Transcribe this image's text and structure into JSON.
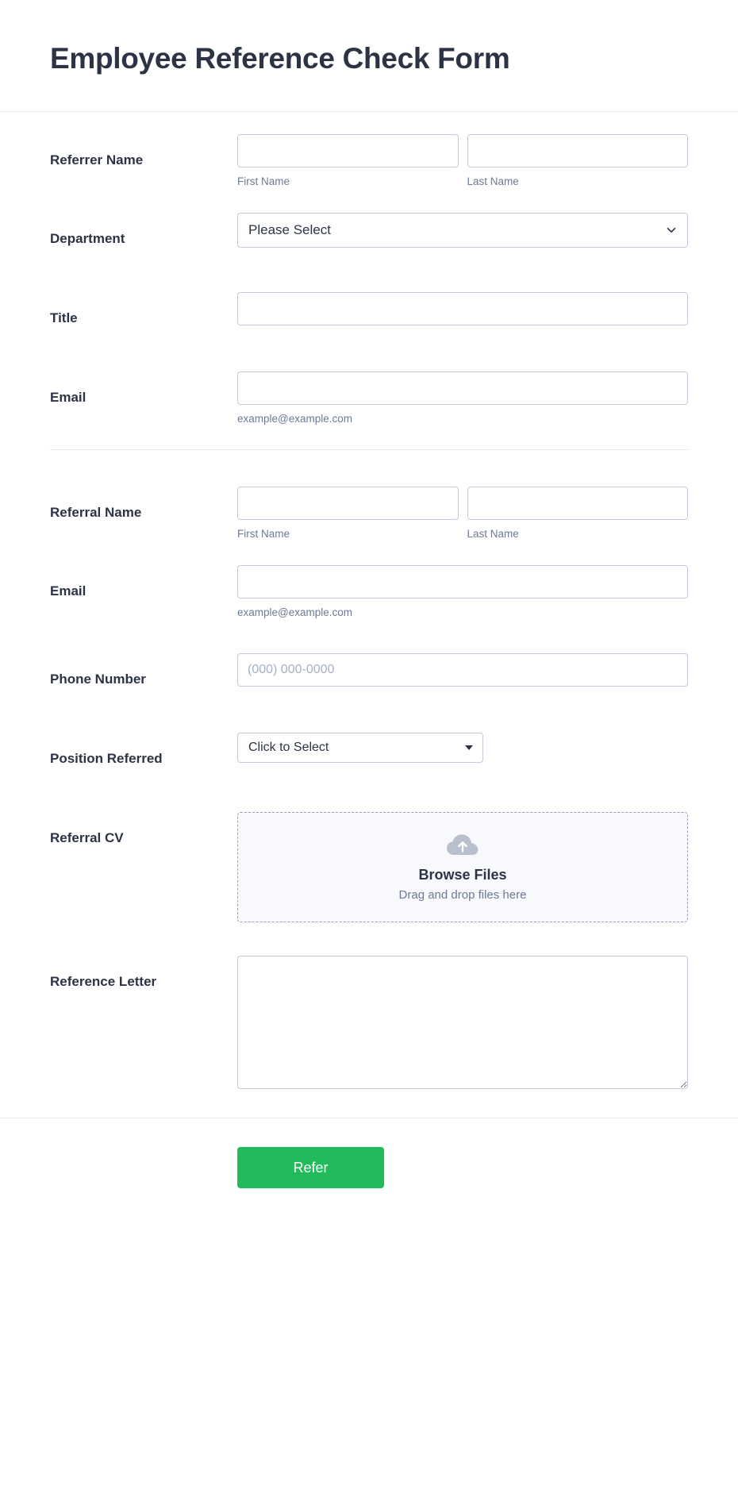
{
  "header": {
    "title": "Employee Reference Check Form"
  },
  "colors": {
    "label_text": "#2c3345",
    "sub_label_text": "#6c7a94",
    "input_border": "#c3cad9",
    "placeholder": "#a6b1c6",
    "submit_green": "#22bb5b",
    "upload_bg": "#f7f9fc",
    "divider": "#e4e6ee"
  },
  "fields": {
    "referrer_name": {
      "label": "Referrer Name",
      "first_name": {
        "value": "",
        "sub_label": "First Name"
      },
      "last_name": {
        "value": "",
        "sub_label": "Last Name"
      }
    },
    "department": {
      "label": "Department",
      "selected": "Please Select",
      "icon": "chevron-down-icon"
    },
    "title": {
      "label": "Title",
      "value": ""
    },
    "referrer_email": {
      "label": "Email",
      "value": "",
      "sub_label": "example@example.com"
    },
    "referral_name": {
      "label": "Referral Name",
      "first_name": {
        "value": "",
        "sub_label": "First Name"
      },
      "last_name": {
        "value": "",
        "sub_label": "Last Name"
      }
    },
    "referral_email": {
      "label": "Email",
      "value": "",
      "sub_label": "example@example.com"
    },
    "phone_number": {
      "label": "Phone Number",
      "value": "",
      "placeholder": "(000) 000-0000"
    },
    "position_referred": {
      "label": "Position Referred",
      "selected": "Click to Select",
      "icon": "caret-down-icon"
    },
    "referral_cv": {
      "label": "Referral CV",
      "browse_label": "Browse Files",
      "drop_hint": "Drag and drop files here",
      "icon": "cloud-upload-icon"
    },
    "reference_letter": {
      "label": "Reference Letter",
      "value": ""
    }
  },
  "footer": {
    "submit_label": "Refer"
  }
}
